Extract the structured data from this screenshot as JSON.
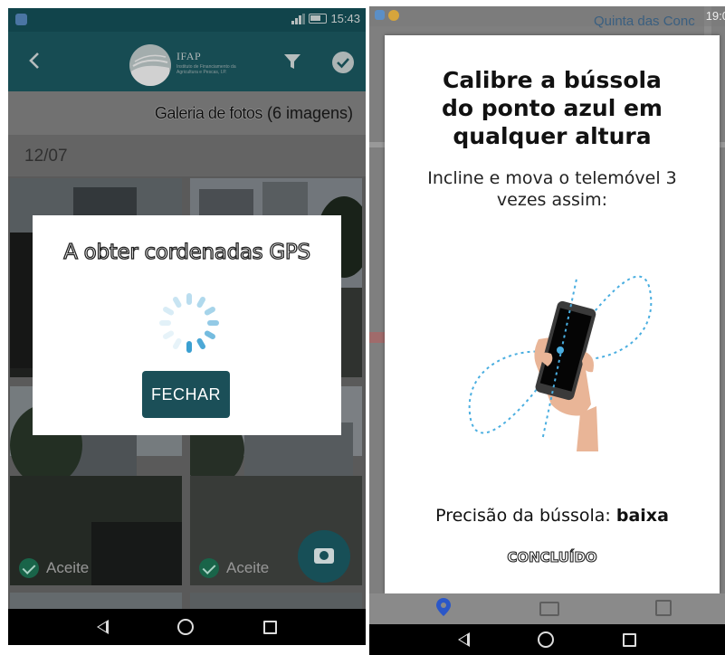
{
  "left_screen": {
    "status_bar": {
      "time": "15:43"
    },
    "app_bar": {
      "logo_title": "IFAP",
      "logo_subtitle": "Instituto de Financiamento da Agricultura e Pescas, I.P."
    },
    "gallery": {
      "title": "Galeria de fotos",
      "count": "(6 imagens)",
      "date": "12/07",
      "photos": [
        {
          "status": ""
        },
        {
          "status": ""
        },
        {
          "status": "Aceite"
        },
        {
          "status": "Aceite"
        }
      ]
    },
    "dialog": {
      "title": "A obter cordenadas GPS",
      "close_label": "FECHAR"
    }
  },
  "right_screen": {
    "status_bar": {
      "time": "19:0",
      "place": "Quinta das Conc"
    },
    "compass_dialog": {
      "title_line1": "Calibre a bússola",
      "title_line2": "do ponto azul em",
      "title_line3": "qualquer altura",
      "instruction_line1": "Incline e mova o telemóvel 3",
      "instruction_line2": "vezes assim:",
      "precision_label": "Precisão da bússola: ",
      "precision_value": "baixa",
      "done_label": "CONCLUÍDO"
    }
  },
  "colors": {
    "app_bar": "#1d5d66",
    "button": "#1b4f58",
    "accept_check": "#1f7a5a",
    "spinner": "#3a9fd1",
    "figure8": "#4aaee0"
  },
  "icons": [
    "back-arrow-icon",
    "filter-icon",
    "check-circle-icon",
    "camera-icon",
    "spinner-icon",
    "phone-in-hand-icon",
    "map-pin-icon"
  ]
}
